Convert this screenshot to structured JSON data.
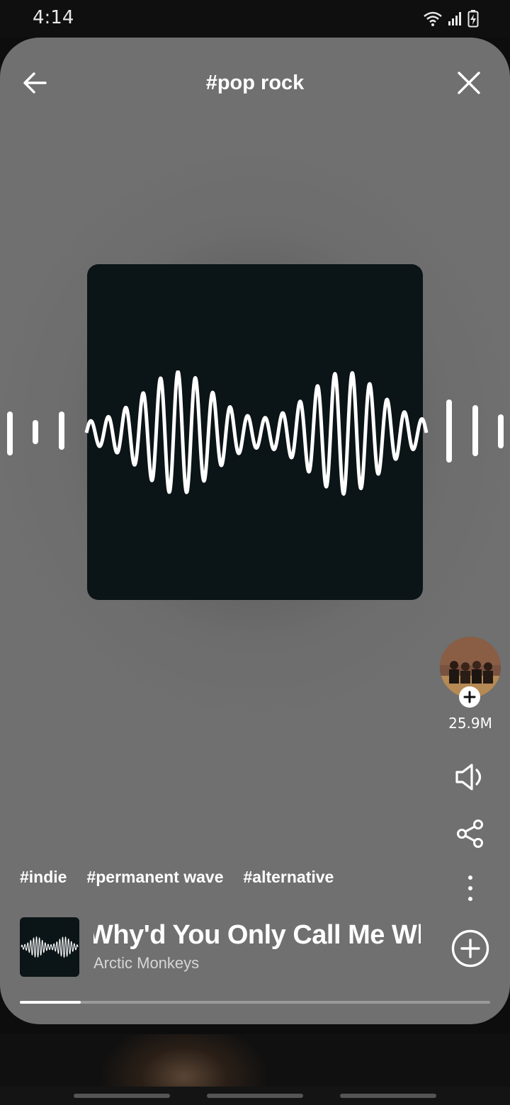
{
  "status_bar": {
    "time": "4:14",
    "icons": [
      "wifi-icon",
      "signal-icon",
      "battery-charging-icon"
    ]
  },
  "header": {
    "title": "#pop rock",
    "back_icon": "arrow-left-icon",
    "close_icon": "close-icon"
  },
  "artist": {
    "followers": "25.9M",
    "follow_icon": "plus-icon"
  },
  "actions": {
    "volume_icon": "speaker-muted-icon",
    "share_icon": "share-icon",
    "more_icon": "more-vertical-icon"
  },
  "tags": [
    "#indie",
    "#permanent wave",
    "#alternative"
  ],
  "track": {
    "title": "Why'd You Only Call Me When You're High?",
    "artist": "Arctic Monkeys",
    "add_icon": "add-circle-icon",
    "progress": 0.13
  },
  "colors": {
    "card_background": "#707070",
    "album_background": "#0b1416",
    "accent": "#ffffff"
  }
}
